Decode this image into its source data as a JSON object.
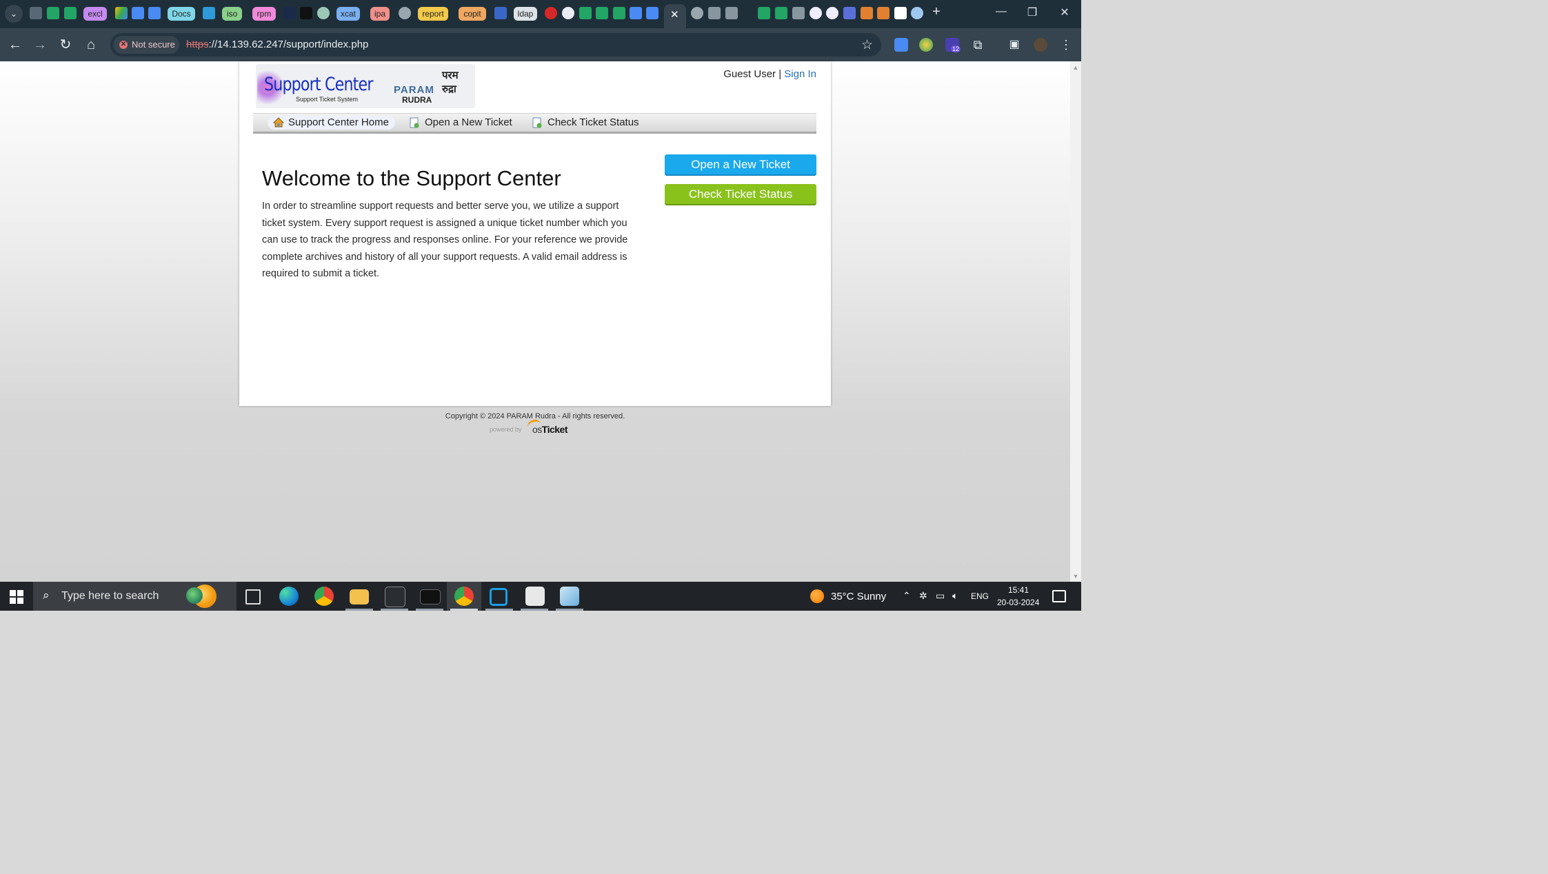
{
  "browser": {
    "tab_labels": [
      "excl",
      "Docs",
      "iso",
      "rpm",
      "xcat",
      "ipa",
      "report",
      "copit",
      "ldap"
    ],
    "security_label": "Not secure",
    "url_scheme": "https",
    "url_rest": "://14.139.62.247/support/index.php",
    "extension_badge": "12"
  },
  "site": {
    "logo": {
      "title": "Support Center",
      "subtitle": "Support Ticket System",
      "brand": "PARAM",
      "brand_sub": "RUDRA",
      "brand_hindi": "परम रुद्रा"
    },
    "user": {
      "name": "Guest User",
      "separator": "|",
      "sign_in": "Sign In"
    },
    "nav": [
      "Support Center Home",
      "Open a New Ticket",
      "Check Ticket Status"
    ],
    "welcome_title": "Welcome to the Support Center",
    "welcome_text": "In order to streamline support requests and better serve you, we utilize a support ticket system. Every support request is assigned a unique ticket number which you can use to track the progress and responses online. For your reference we provide complete archives and history of all your support requests. A valid email address is required to submit a ticket.",
    "buttons": {
      "open": "Open a New Ticket",
      "check": "Check Ticket Status"
    },
    "footer": {
      "copyright": "Copyright © 2024 PARAM Rudra - All rights reserved.",
      "powered_by": "powered by",
      "osticket_os": "os",
      "osticket_ticket": "Ticket"
    }
  },
  "taskbar": {
    "search_placeholder": "Type here to search",
    "weather": "35°C  Sunny",
    "language": "ENG",
    "time": "15:41",
    "date": "20-03-2024"
  },
  "colors": {
    "accent_blue": "#1aa9ec",
    "accent_green": "#8ac21c",
    "link": "#2a70b8"
  }
}
